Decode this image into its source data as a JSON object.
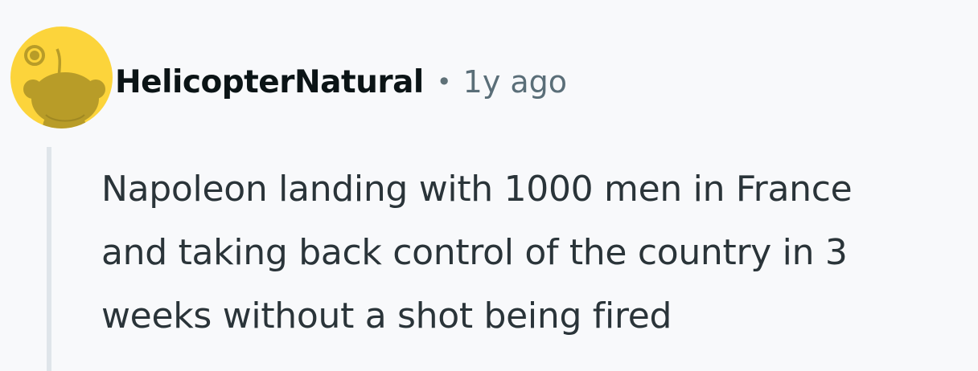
{
  "comment": {
    "avatar": {
      "icon": "snoo-avatar-icon",
      "background_color": "#fcd43b",
      "figure_color": "#b89c28"
    },
    "author": "HelicopterNatural",
    "separator": "•",
    "timestamp": "1y ago",
    "body": "Napoleon landing with 1000 men in France\nand taking back control of the country in 3\nweeks without a shot being fired"
  },
  "colors": {
    "background": "#f8f9fb",
    "thread_line": "#dfe5ea",
    "username": "#0b1416",
    "timestamp": "#5a6e78",
    "body_text": "#2a3439"
  }
}
